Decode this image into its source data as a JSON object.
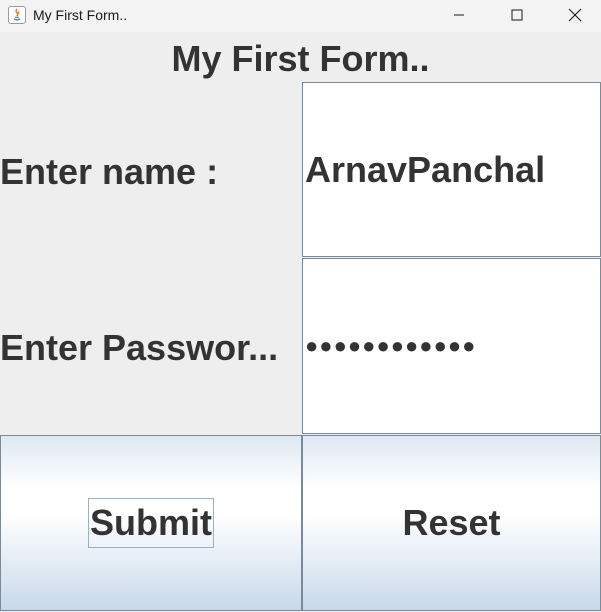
{
  "window": {
    "title": "My First Form.."
  },
  "form": {
    "title": "My First Form..",
    "name_label": "Enter name :",
    "name_value": "ArnavPanchal",
    "password_label": "Enter Passwor...",
    "password_value": "●●●●●●●●●●●●",
    "submit_label": "Submit",
    "reset_label": "Reset"
  },
  "icons": {
    "app": "java-icon",
    "minimize": "minimize-icon",
    "maximize": "maximize-icon",
    "close": "close-icon"
  }
}
